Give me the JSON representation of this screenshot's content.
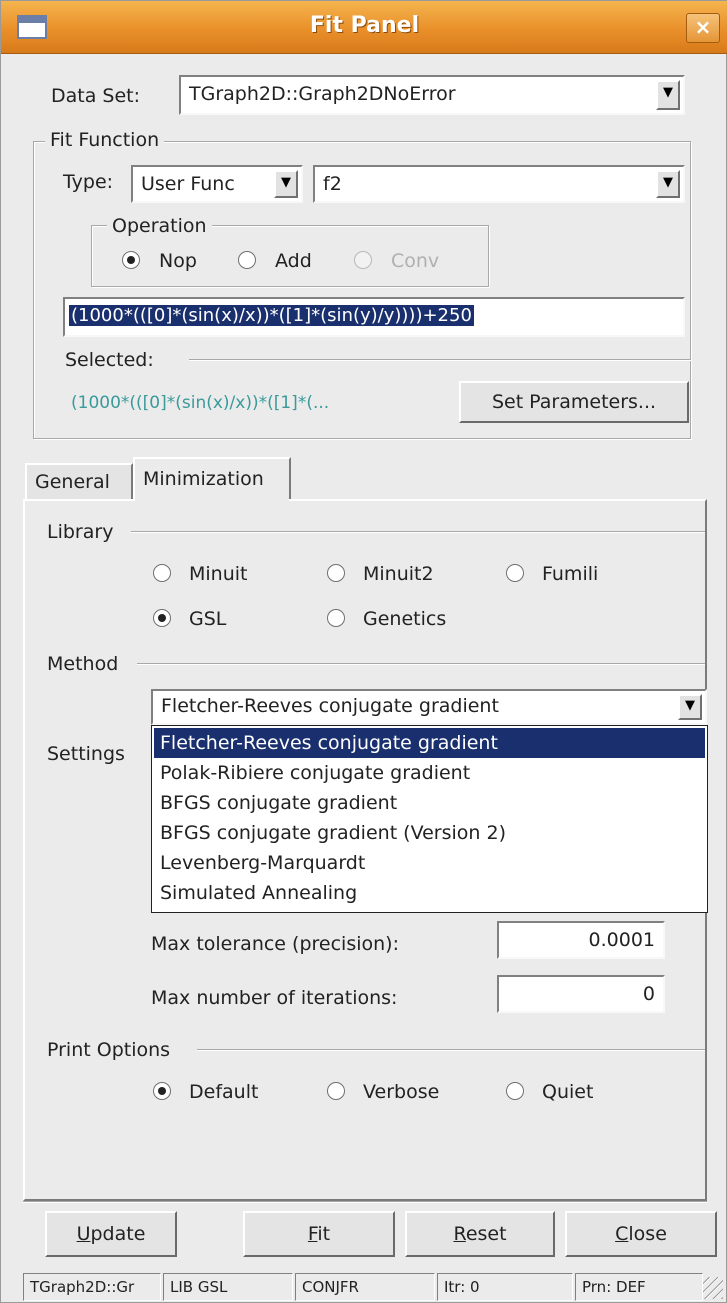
{
  "window": {
    "title": "Fit Panel",
    "close_glyph": "×"
  },
  "data_set": {
    "label": "Data Set:",
    "value": "TGraph2D::Graph2DNoError"
  },
  "fit_function": {
    "group_label": "Fit Function",
    "type_label": "Type:",
    "type_value": "User Func",
    "func_value": "f2",
    "operation": {
      "group_label": "Operation",
      "options": [
        "Nop",
        "Add",
        "Conv"
      ],
      "selected": "Nop"
    },
    "formula": "(1000*(([0]*(sin(x)/x))*([1]*(sin(y)/y))))+250",
    "selected_label": "Selected:",
    "selected_text": "(1000*(([0]*(sin(x)/x))*([1]*(...",
    "set_parameters_label": "Set Parameters..."
  },
  "tabs": {
    "general": "General",
    "minimization": "Minimization",
    "active": "Minimization"
  },
  "library": {
    "group_label": "Library",
    "options": [
      "Minuit",
      "Minuit2",
      "Fumili",
      "GSL",
      "Genetics"
    ],
    "selected": "GSL"
  },
  "method": {
    "group_label": "Method",
    "value": "Fletcher-Reeves conjugate gradient",
    "options": [
      "Fletcher-Reeves conjugate gradient",
      "Polak-Ribiere conjugate gradient",
      "BFGS conjugate gradient",
      "BFGS conjugate gradient (Version 2)",
      "Levenberg-Marquardt",
      "Simulated Annealing"
    ]
  },
  "settings": {
    "group_label": "Settings",
    "max_tolerance_label": "Max tolerance (precision):",
    "max_tolerance_value": "0.0001",
    "max_iterations_label": "Max number of iterations:",
    "max_iterations_value": "0"
  },
  "print_options": {
    "group_label": "Print Options",
    "options": [
      "Default",
      "Verbose",
      "Quiet"
    ],
    "selected": "Default"
  },
  "buttons": {
    "update": {
      "first": "U",
      "rest": "pdate"
    },
    "fit": {
      "first": "F",
      "rest": "it"
    },
    "reset": {
      "first": "R",
      "rest": "eset"
    },
    "close": {
      "first": "C",
      "rest": "lose"
    }
  },
  "status": [
    "TGraph2D::Gr",
    "LIB GSL",
    "CONJFR",
    "Itr: 0",
    "Prn: DEF"
  ]
}
